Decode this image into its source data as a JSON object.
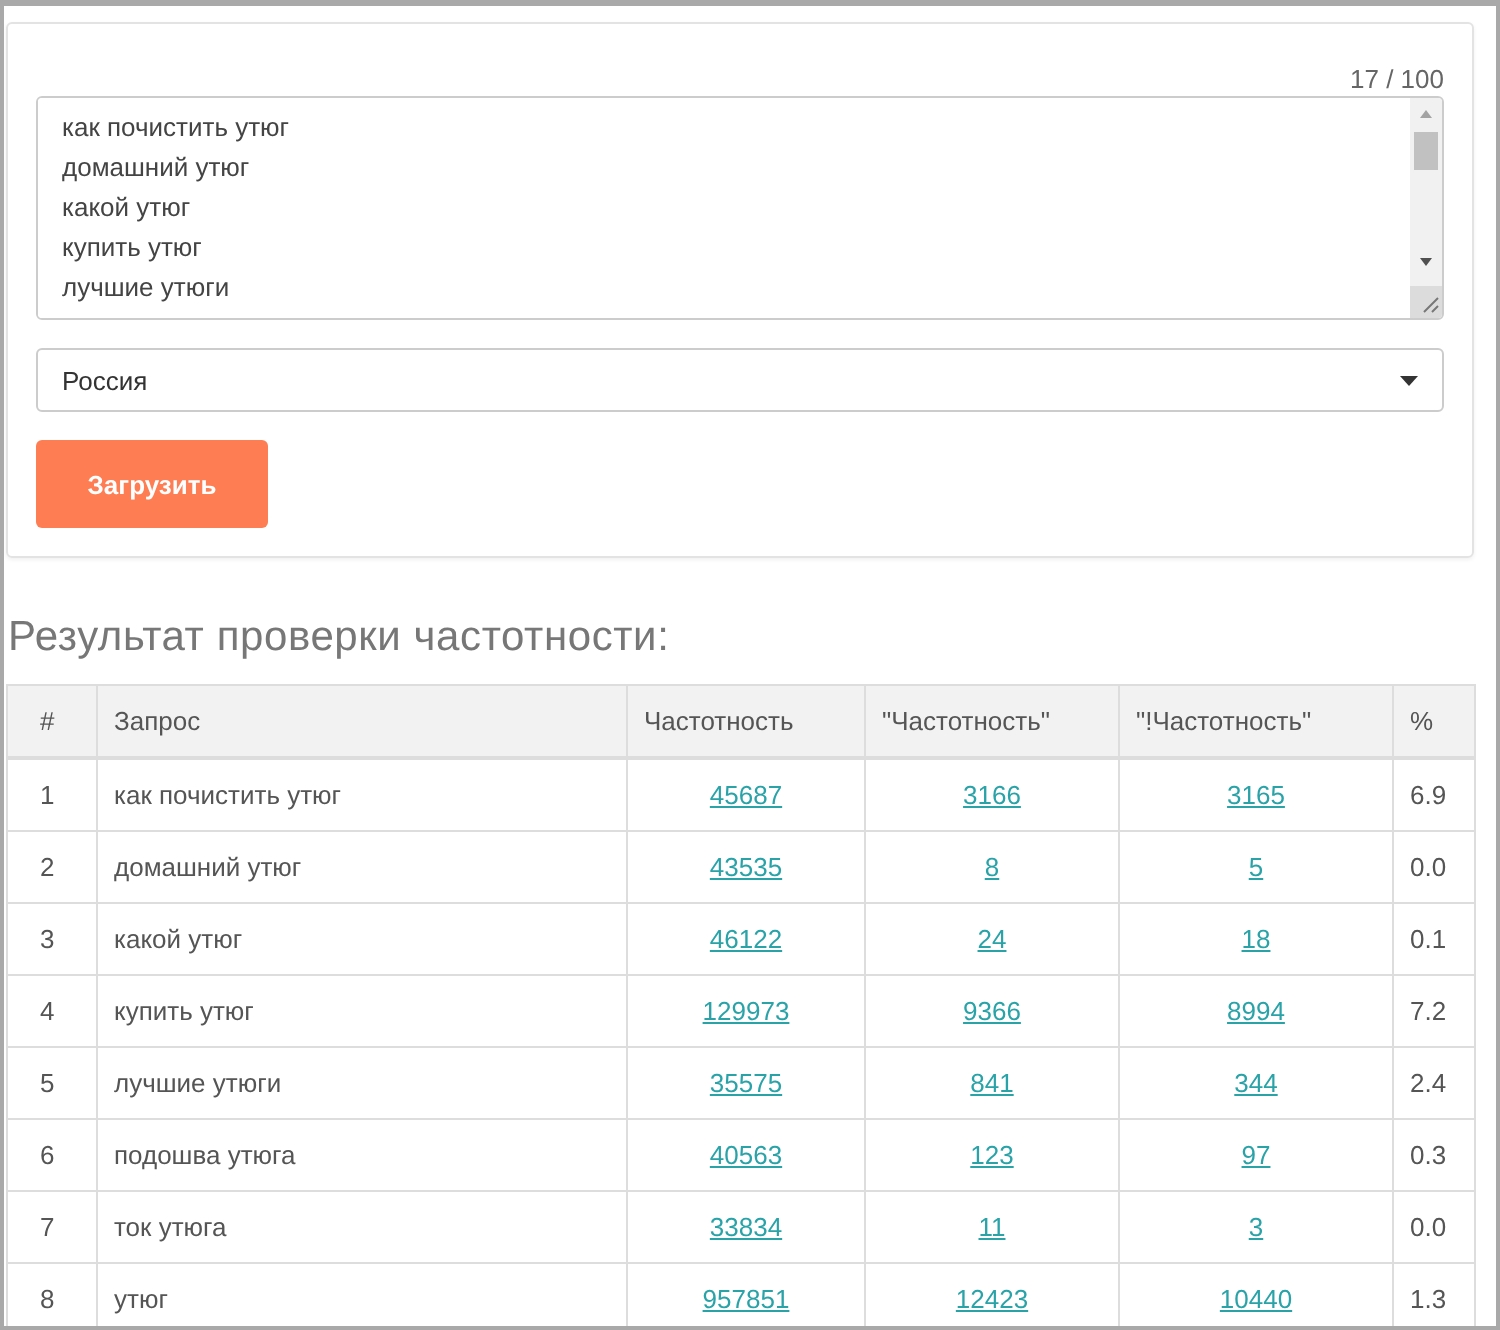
{
  "form": {
    "counter": "17 / 100",
    "queries": [
      "как почистить утюг",
      "домашний утюг",
      "какой утюг",
      "купить утюг",
      "лучшие утюги"
    ],
    "region": "Россия",
    "submit": "Загрузить"
  },
  "results": {
    "title": "Результат проверки частотности:",
    "table": {
      "columns": [
        "#",
        "Запрос",
        "Частотность",
        "\"Частотность\"",
        "\"!Частотность\"",
        "%"
      ],
      "rows": [
        {
          "n": "1",
          "query": "как почистить утюг",
          "freq": "45687",
          "quoted": "3166",
          "exact": "3165",
          "percent": "6.9"
        },
        {
          "n": "2",
          "query": "домашний утюг",
          "freq": "43535",
          "quoted": "8",
          "exact": "5",
          "percent": "0.0"
        },
        {
          "n": "3",
          "query": "какой утюг",
          "freq": "46122",
          "quoted": "24",
          "exact": "18",
          "percent": "0.1"
        },
        {
          "n": "4",
          "query": "купить утюг",
          "freq": "129973",
          "quoted": "9366",
          "exact": "8994",
          "percent": "7.2"
        },
        {
          "n": "5",
          "query": "лучшие утюги",
          "freq": "35575",
          "quoted": "841",
          "exact": "344",
          "percent": "2.4"
        },
        {
          "n": "6",
          "query": "подошва утюга",
          "freq": "40563",
          "quoted": "123",
          "exact": "97",
          "percent": "0.3"
        },
        {
          "n": "7",
          "query": "ток утюга",
          "freq": "33834",
          "quoted": "11",
          "exact": "3",
          "percent": "0.0"
        },
        {
          "n": "8",
          "query": "утюг",
          "freq": "957851",
          "quoted": "12423",
          "exact": "10440",
          "percent": "1.3"
        }
      ]
    }
  }
}
